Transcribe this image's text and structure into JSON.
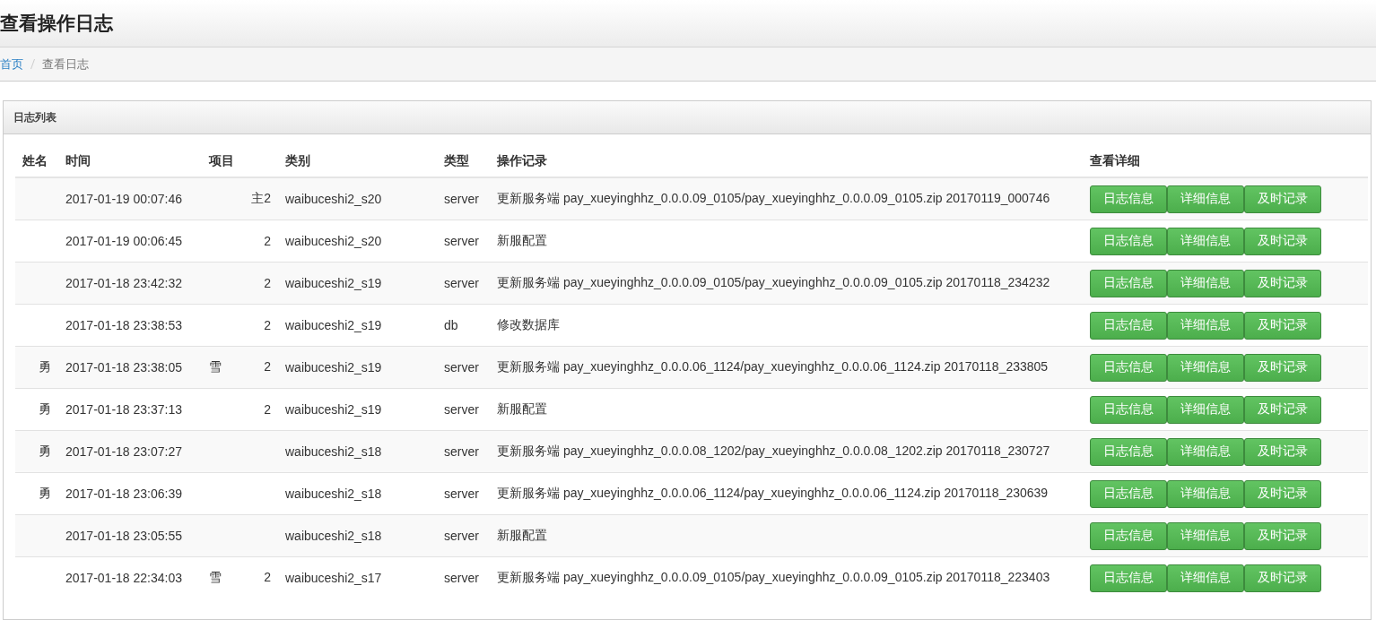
{
  "page_title": "查看操作日志",
  "breadcrumb": [
    {
      "label": "首页",
      "link": true
    },
    {
      "label": "查看日志",
      "link": false
    }
  ],
  "panel": {
    "title": "日志列表",
    "columns": [
      "姓名",
      "时间",
      "项目",
      "类别",
      "类型",
      "操作记录",
      "查看详细"
    ],
    "rows": [
      {
        "time": "2017-01-19 00:07:46",
        "project": [
          "主2"
        ],
        "category": "waibuceshi2_s20",
        "type": "server",
        "record": "更新服务端 pay_xueyinghhz_0.0.0.09_0105/pay_xueyinghhz_0.0.0.09_0105.zip 20170119_000746",
        "actions": [
          "日志信息",
          "详细信息",
          "及时记录"
        ]
      },
      {
        "time": "2017-01-19 00:06:45",
        "project": [
          "2"
        ],
        "category": "waibuceshi2_s20",
        "type": "server",
        "record": "新服配置",
        "actions": [
          "日志信息",
          "详细信息",
          "及时记录"
        ]
      },
      {
        "time": "2017-01-18 23:42:32",
        "project": [
          "2"
        ],
        "category": "waibuceshi2_s19",
        "type": "server",
        "record": "更新服务端 pay_xueyinghhz_0.0.0.09_0105/pay_xueyinghhz_0.0.0.09_0105.zip 20170118_234232",
        "actions": [
          "日志信息",
          "详细信息",
          "及时记录"
        ]
      },
      {
        "time": "2017-01-18 23:38:53",
        "project": [
          "2"
        ],
        "category": "waibuceshi2_s19",
        "type": "db",
        "record": "修改数据库",
        "actions": [
          "日志信息",
          "详细信息",
          "及时记录"
        ]
      },
      {
        "name": "勇",
        "time": "2017-01-18 23:38:05",
        "project": [
          "雪",
          "2"
        ],
        "category": "waibuceshi2_s19",
        "type": "server",
        "record": "更新服务端 pay_xueyinghhz_0.0.0.06_1124/pay_xueyinghhz_0.0.0.06_1124.zip 20170118_233805",
        "actions": [
          "日志信息",
          "详细信息",
          "及时记录"
        ]
      },
      {
        "name": "勇",
        "time": "2017-01-18 23:37:13",
        "project": [
          "2"
        ],
        "category": "waibuceshi2_s19",
        "type": "server",
        "record": "新服配置",
        "actions": [
          "日志信息",
          "详细信息",
          "及时记录"
        ]
      },
      {
        "name": "勇",
        "time": "2017-01-18 23:07:27",
        "category": "waibuceshi2_s18",
        "type": "server",
        "record": "更新服务端 pay_xueyinghhz_0.0.0.08_1202/pay_xueyinghhz_0.0.0.08_1202.zip 20170118_230727",
        "actions": [
          "日志信息",
          "详细信息",
          "及时记录"
        ]
      },
      {
        "name": "勇",
        "time": "2017-01-18 23:06:39",
        "category": "waibuceshi2_s18",
        "type": "server",
        "record": "更新服务端 pay_xueyinghhz_0.0.0.06_1124/pay_xueyinghhz_0.0.0.06_1124.zip 20170118_230639",
        "actions": [
          "日志信息",
          "详细信息",
          "及时记录"
        ]
      },
      {
        "time": "2017-01-18 23:05:55",
        "category": "waibuceshi2_s18",
        "type": "server",
        "record": "新服配置",
        "actions": [
          "日志信息",
          "详细信息",
          "及时记录"
        ]
      },
      {
        "time": "2017-01-18 22:34:03",
        "project": [
          "雪",
          "2"
        ],
        "category": "waibuceshi2_s17",
        "type": "server",
        "record": "更新服务端 pay_xueyinghhz_0.0.0.09_0105/pay_xueyinghhz_0.0.0.09_0105.zip 20170118_223403",
        "actions": [
          "日志信息",
          "详细信息",
          "及时记录"
        ]
      }
    ]
  }
}
